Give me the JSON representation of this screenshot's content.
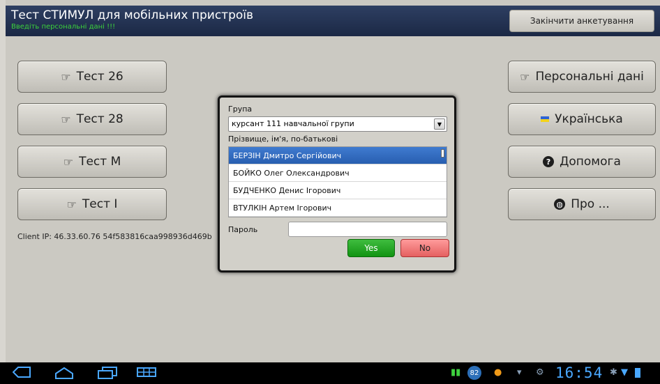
{
  "header": {
    "title": "Тест СТИМУЛ для мобільних пристроїв",
    "subtitle": "Введіть персональні дані !!!",
    "finish_label": "Закінчити анкетування"
  },
  "left_buttons": [
    {
      "label": "Тест 26",
      "icon": "hand-pointer-icon"
    },
    {
      "label": "Тест 28",
      "icon": "hand-pointer-icon"
    },
    {
      "label": "Тест М",
      "icon": "hand-pointer-icon"
    },
    {
      "label": "Тест І",
      "icon": "hand-pointer-icon"
    }
  ],
  "right_buttons": [
    {
      "label": "Персональні дані",
      "icon": "hand-pointer-icon"
    },
    {
      "label": "Українська",
      "icon": "flag-icon"
    },
    {
      "label": "Допомога",
      "icon": "help-icon"
    },
    {
      "label": "Про ...",
      "icon": "globe-icon"
    }
  ],
  "client_ip": "Client IP: 46.33.60.76 54f583816caa998936d469b",
  "dialog": {
    "group_label": "Група",
    "group_value": "курсант 111 навчальної групи",
    "name_label": "Прізвище, ім'я, по-батькові",
    "names": [
      "БЕРЗІН Дмитро Сергійович",
      "БОЙКО Олег Олександрович",
      "БУДЧЕНКО Денис Ігорович",
      "ВТУЛКІН Артем Ігорович"
    ],
    "selected_index": 0,
    "password_label": "Пароль",
    "password_value": "",
    "yes_label": "Yes",
    "no_label": "No"
  },
  "system_bar": {
    "time": "16:54",
    "notification_count": "82"
  },
  "colors": {
    "header_bg": "#1b2845",
    "subtitle": "#3cd23c",
    "selected_row": "#285eb0",
    "yes": "#129312",
    "no": "#e46060",
    "system_icons": "#4aa8ff"
  }
}
